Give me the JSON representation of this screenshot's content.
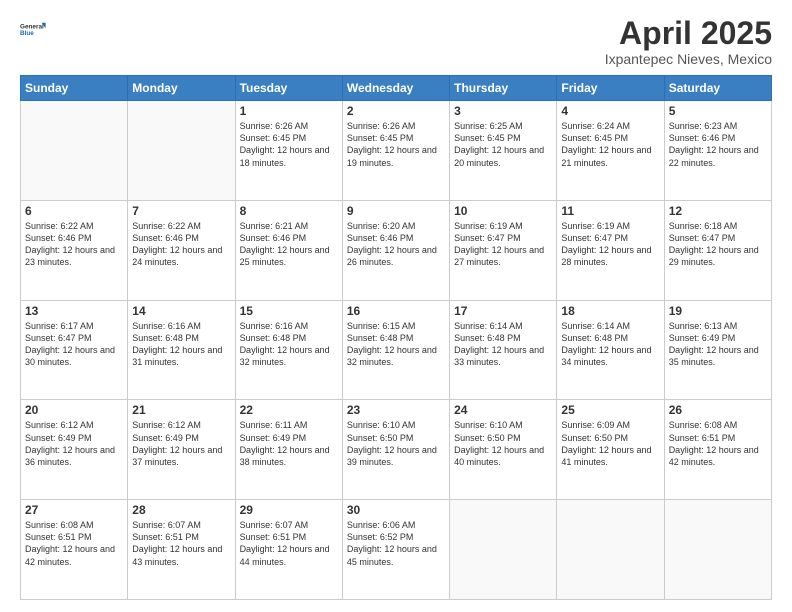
{
  "logo": {
    "line1": "General",
    "line2": "Blue"
  },
  "header": {
    "month": "April 2025",
    "location": "Ixpantepec Nieves, Mexico"
  },
  "days_of_week": [
    "Sunday",
    "Monday",
    "Tuesday",
    "Wednesday",
    "Thursday",
    "Friday",
    "Saturday"
  ],
  "weeks": [
    [
      {
        "day": "",
        "info": ""
      },
      {
        "day": "",
        "info": ""
      },
      {
        "day": "1",
        "info": "Sunrise: 6:26 AM\nSunset: 6:45 PM\nDaylight: 12 hours and 18 minutes."
      },
      {
        "day": "2",
        "info": "Sunrise: 6:26 AM\nSunset: 6:45 PM\nDaylight: 12 hours and 19 minutes."
      },
      {
        "day": "3",
        "info": "Sunrise: 6:25 AM\nSunset: 6:45 PM\nDaylight: 12 hours and 20 minutes."
      },
      {
        "day": "4",
        "info": "Sunrise: 6:24 AM\nSunset: 6:45 PM\nDaylight: 12 hours and 21 minutes."
      },
      {
        "day": "5",
        "info": "Sunrise: 6:23 AM\nSunset: 6:46 PM\nDaylight: 12 hours and 22 minutes."
      }
    ],
    [
      {
        "day": "6",
        "info": "Sunrise: 6:22 AM\nSunset: 6:46 PM\nDaylight: 12 hours and 23 minutes."
      },
      {
        "day": "7",
        "info": "Sunrise: 6:22 AM\nSunset: 6:46 PM\nDaylight: 12 hours and 24 minutes."
      },
      {
        "day": "8",
        "info": "Sunrise: 6:21 AM\nSunset: 6:46 PM\nDaylight: 12 hours and 25 minutes."
      },
      {
        "day": "9",
        "info": "Sunrise: 6:20 AM\nSunset: 6:46 PM\nDaylight: 12 hours and 26 minutes."
      },
      {
        "day": "10",
        "info": "Sunrise: 6:19 AM\nSunset: 6:47 PM\nDaylight: 12 hours and 27 minutes."
      },
      {
        "day": "11",
        "info": "Sunrise: 6:19 AM\nSunset: 6:47 PM\nDaylight: 12 hours and 28 minutes."
      },
      {
        "day": "12",
        "info": "Sunrise: 6:18 AM\nSunset: 6:47 PM\nDaylight: 12 hours and 29 minutes."
      }
    ],
    [
      {
        "day": "13",
        "info": "Sunrise: 6:17 AM\nSunset: 6:47 PM\nDaylight: 12 hours and 30 minutes."
      },
      {
        "day": "14",
        "info": "Sunrise: 6:16 AM\nSunset: 6:48 PM\nDaylight: 12 hours and 31 minutes."
      },
      {
        "day": "15",
        "info": "Sunrise: 6:16 AM\nSunset: 6:48 PM\nDaylight: 12 hours and 32 minutes."
      },
      {
        "day": "16",
        "info": "Sunrise: 6:15 AM\nSunset: 6:48 PM\nDaylight: 12 hours and 32 minutes."
      },
      {
        "day": "17",
        "info": "Sunrise: 6:14 AM\nSunset: 6:48 PM\nDaylight: 12 hours and 33 minutes."
      },
      {
        "day": "18",
        "info": "Sunrise: 6:14 AM\nSunset: 6:48 PM\nDaylight: 12 hours and 34 minutes."
      },
      {
        "day": "19",
        "info": "Sunrise: 6:13 AM\nSunset: 6:49 PM\nDaylight: 12 hours and 35 minutes."
      }
    ],
    [
      {
        "day": "20",
        "info": "Sunrise: 6:12 AM\nSunset: 6:49 PM\nDaylight: 12 hours and 36 minutes."
      },
      {
        "day": "21",
        "info": "Sunrise: 6:12 AM\nSunset: 6:49 PM\nDaylight: 12 hours and 37 minutes."
      },
      {
        "day": "22",
        "info": "Sunrise: 6:11 AM\nSunset: 6:49 PM\nDaylight: 12 hours and 38 minutes."
      },
      {
        "day": "23",
        "info": "Sunrise: 6:10 AM\nSunset: 6:50 PM\nDaylight: 12 hours and 39 minutes."
      },
      {
        "day": "24",
        "info": "Sunrise: 6:10 AM\nSunset: 6:50 PM\nDaylight: 12 hours and 40 minutes."
      },
      {
        "day": "25",
        "info": "Sunrise: 6:09 AM\nSunset: 6:50 PM\nDaylight: 12 hours and 41 minutes."
      },
      {
        "day": "26",
        "info": "Sunrise: 6:08 AM\nSunset: 6:51 PM\nDaylight: 12 hours and 42 minutes."
      }
    ],
    [
      {
        "day": "27",
        "info": "Sunrise: 6:08 AM\nSunset: 6:51 PM\nDaylight: 12 hours and 42 minutes."
      },
      {
        "day": "28",
        "info": "Sunrise: 6:07 AM\nSunset: 6:51 PM\nDaylight: 12 hours and 43 minutes."
      },
      {
        "day": "29",
        "info": "Sunrise: 6:07 AM\nSunset: 6:51 PM\nDaylight: 12 hours and 44 minutes."
      },
      {
        "day": "30",
        "info": "Sunrise: 6:06 AM\nSunset: 6:52 PM\nDaylight: 12 hours and 45 minutes."
      },
      {
        "day": "",
        "info": ""
      },
      {
        "day": "",
        "info": ""
      },
      {
        "day": "",
        "info": ""
      }
    ]
  ]
}
